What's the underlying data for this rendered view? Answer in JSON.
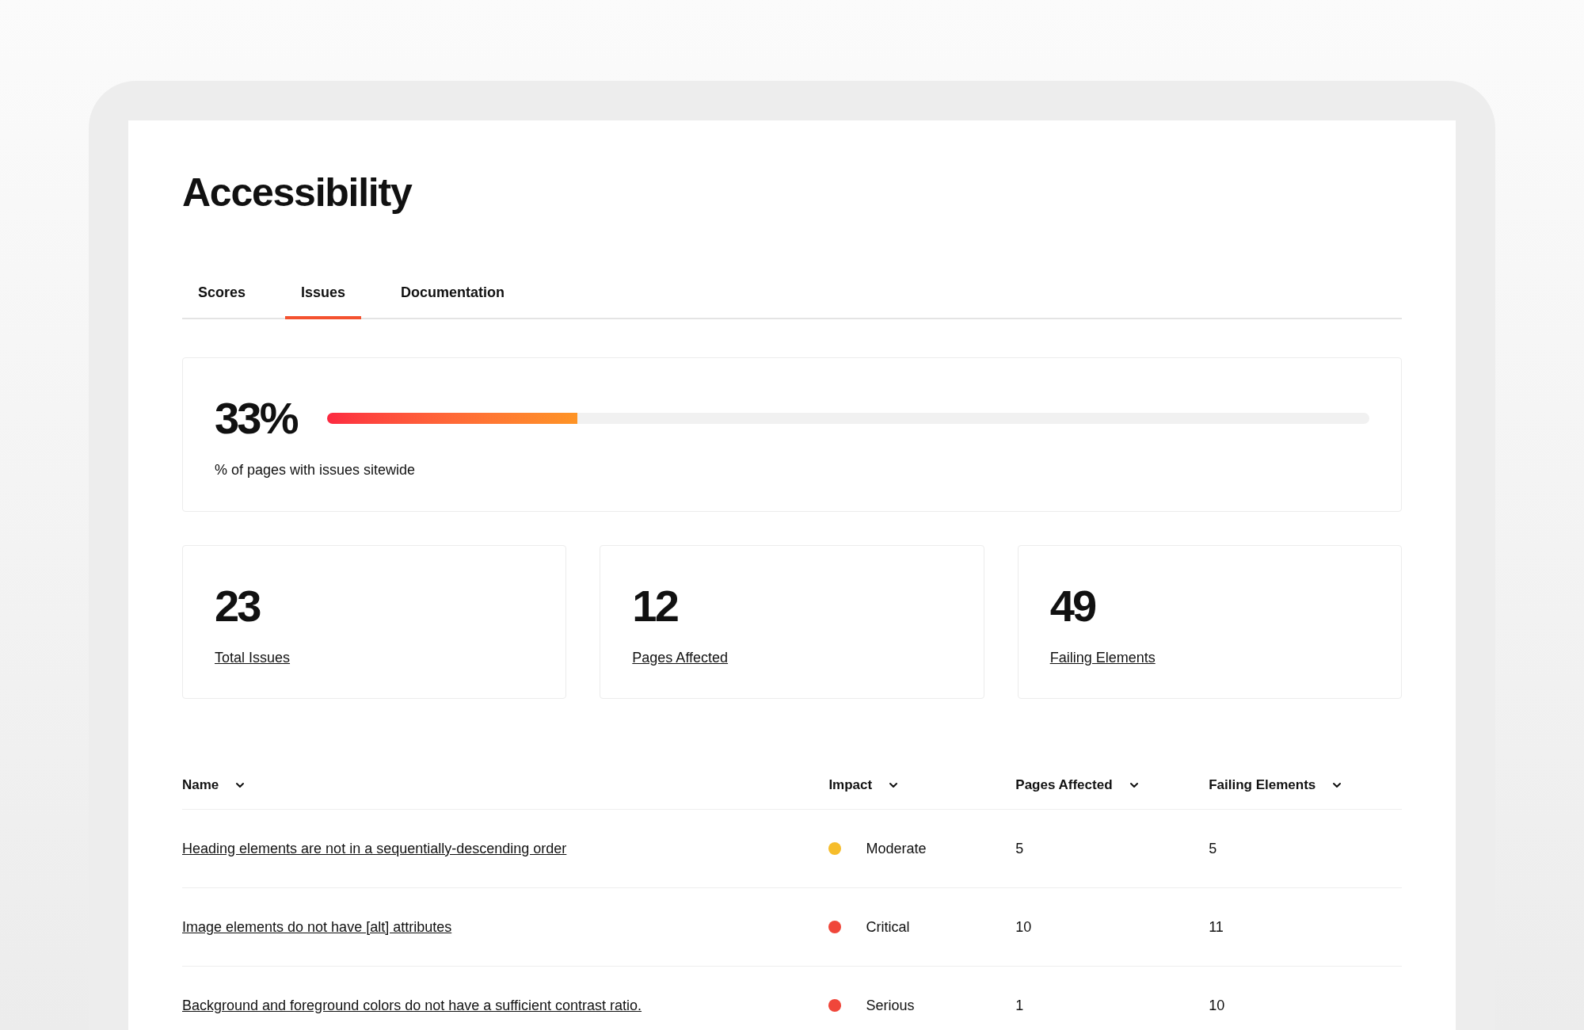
{
  "title": "Accessibility",
  "tabs": [
    {
      "label": "Scores",
      "selected": false
    },
    {
      "label": "Issues",
      "selected": true
    },
    {
      "label": "Documentation",
      "selected": false
    }
  ],
  "summary": {
    "value": "33%",
    "level": 0.24,
    "caption": "% of pages with issues sitewide"
  },
  "stats": [
    {
      "value": "23",
      "label": "Total Issues"
    },
    {
      "value": "12",
      "label": "Pages Affected"
    },
    {
      "value": "49",
      "label": "Failing Elements"
    }
  ],
  "table": {
    "columns": [
      "Name",
      "Impact",
      "Pages Affected",
      "Failing Elements"
    ],
    "rows": [
      {
        "name": "Heading elements are not in a sequentially-descending order",
        "impact": "Moderate",
        "color": "#f6bd2b",
        "pages": "5",
        "elements": "5"
      },
      {
        "name": "Image elements do not have [alt] attributes",
        "impact": "Critical",
        "color": "#f0463a",
        "pages": "10",
        "elements": "11"
      },
      {
        "name": "Background and foreground colors do not have a sufficient contrast ratio.",
        "impact": "Serious",
        "color": "#f0463a",
        "pages": "1",
        "elements": "10"
      }
    ]
  }
}
